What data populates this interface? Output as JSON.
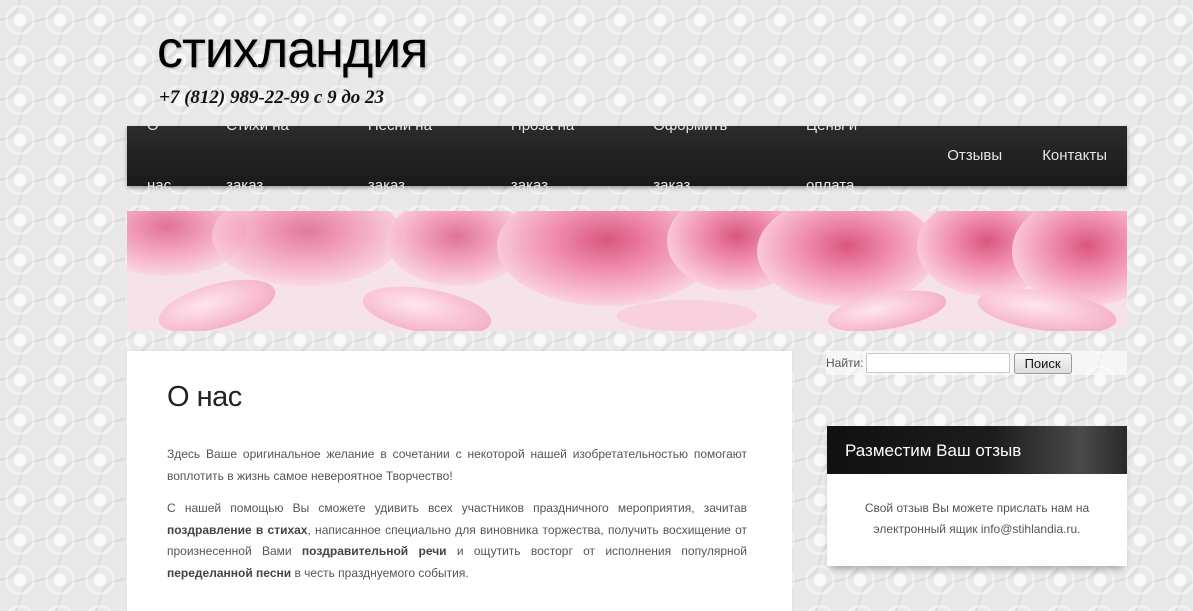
{
  "header": {
    "site_title": "стихландия",
    "phone": "+7 (812) 989-22-99 с 9 до 23"
  },
  "nav": {
    "items": [
      {
        "label": "О нас"
      },
      {
        "label": "Стихи на заказ"
      },
      {
        "label": "Песни на заказ"
      },
      {
        "label": "Проза на заказ"
      },
      {
        "label": "Оформить заказ"
      },
      {
        "label": "Цены и оплата"
      },
      {
        "label": "Отзывы"
      },
      {
        "label": "Контакты"
      }
    ]
  },
  "main": {
    "title": "О нас",
    "paragraph1": "Здесь Ваше оригинальное желание в сочетании с некоторой нашей изобретательностью помогают воплотить в жизнь самое невероятное Творчество!",
    "paragraph2": {
      "t1": "С нашей помощью Вы сможете удивить всех участников праздничного мероприятия, зачитав ",
      "b1": "поздравление в стихах",
      "t2": ", написанное специально для виновника торжества, получить восхищение от произнесенной Вами ",
      "b2": "поздравительной речи",
      "t3": " и ощутить восторг от исполнения популярной ",
      "b3": "переделанной песни",
      "t4": " в честь празднуемого события."
    }
  },
  "sidebar": {
    "search": {
      "label": "Найти:",
      "placeholder": "",
      "button": "Поиск"
    },
    "widget": {
      "title": "Разместим Ваш отзыв",
      "text": "Свой отзыв Вы можете прислать нам на электронный ящик info@stihlandia.ru."
    }
  },
  "colors": {
    "nav_bg": "#222222",
    "nav_text": "#e6e6e6",
    "body_text": "#555555",
    "rose_pink": "#f3a7c0"
  }
}
